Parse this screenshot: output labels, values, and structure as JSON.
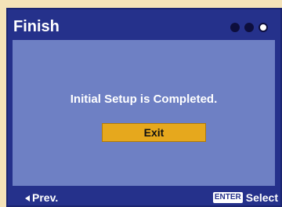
{
  "header": {
    "title": "Finish",
    "steps": [
      "filled",
      "filled",
      "empty"
    ]
  },
  "main": {
    "message": "Initial Setup is Completed.",
    "exit_label": "Exit"
  },
  "footer": {
    "prev_label": "Prev.",
    "enter_key_label": "ENTER",
    "select_label": "Select"
  },
  "colors": {
    "outer_background": "#f4e2b8",
    "screen_background": "#25318b",
    "panel_background": "#6e80c4",
    "button_background": "#e6a81d"
  }
}
